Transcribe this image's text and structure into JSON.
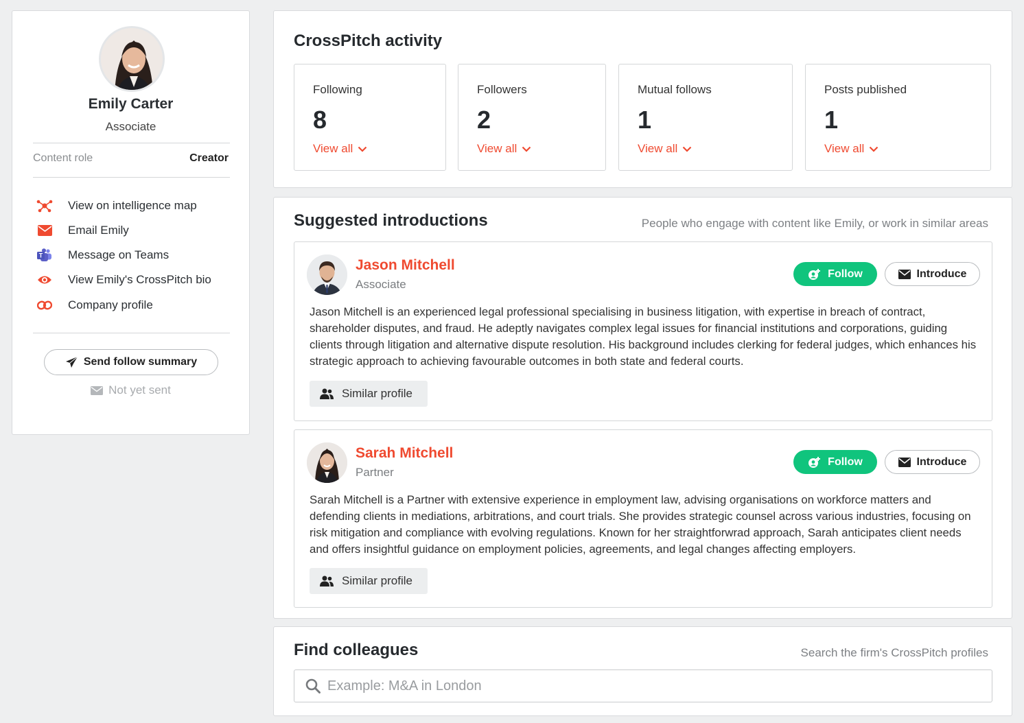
{
  "profile": {
    "name": "Emily Carter",
    "title": "Associate",
    "content_role_label": "Content role",
    "content_role_value": "Creator",
    "links": [
      {
        "label": "View on intelligence map",
        "icon": "network-icon"
      },
      {
        "label": "Email Emily",
        "icon": "envelope-icon"
      },
      {
        "label": "Message on Teams",
        "icon": "teams-icon"
      },
      {
        "label": "View Emily's CrossPitch bio",
        "icon": "eye-icon"
      },
      {
        "label": "Company profile",
        "icon": "link-icon"
      }
    ],
    "send_button": "Send follow summary",
    "send_status": "Not yet sent"
  },
  "activity": {
    "title": "CrossPitch activity",
    "stats": [
      {
        "label": "Following",
        "value": "8",
        "link": "View all"
      },
      {
        "label": "Followers",
        "value": "2",
        "link": "View all"
      },
      {
        "label": "Mutual follows",
        "value": "1",
        "link": "View all"
      },
      {
        "label": "Posts published",
        "value": "1",
        "link": "View all"
      }
    ]
  },
  "suggestions": {
    "title": "Suggested introductions",
    "subtitle": "People who engage with content like Emily, or work in similar areas",
    "people": [
      {
        "name": "Jason Mitchell",
        "role": "Associate",
        "follow_label": "Follow",
        "introduce_label": "Introduce",
        "bio": "Jason Mitchell is an experienced legal professional specialising in business litigation, with expertise in breach of contract, shareholder disputes, and fraud. He adeptly navigates complex legal issues for financial institutions and corporations, guiding clients through litigation and alternative dispute resolution. His background includes clerking for federal judges, which enhances his strategic approach to achieving favourable outcomes in both state and federal courts.",
        "similar_label": "Similar profile"
      },
      {
        "name": "Sarah Mitchell",
        "role": "Partner",
        "follow_label": "Follow",
        "introduce_label": "Introduce",
        "bio": "Sarah Mitchell is a Partner with extensive experience in employment law, advising organisations on workforce matters and defending clients in mediations, arbitrations, and court trials. She provides strategic counsel across various industries, focusing on risk mitigation and compliance with evolving regulations. Known for her straightforwrad approach, Sarah anticipates client needs and offers insightful guidance on employment policies, agreements, and legal changes affecting employers.",
        "similar_label": "Similar profile"
      }
    ]
  },
  "find": {
    "title": "Find colleagues",
    "subtitle": "Search the firm's CrossPitch profiles",
    "placeholder": "Example: M&A in London"
  },
  "colors": {
    "accent": "#ef4a30",
    "follow_green": "#10c47d",
    "teams_purple": "#5b5fc7"
  }
}
